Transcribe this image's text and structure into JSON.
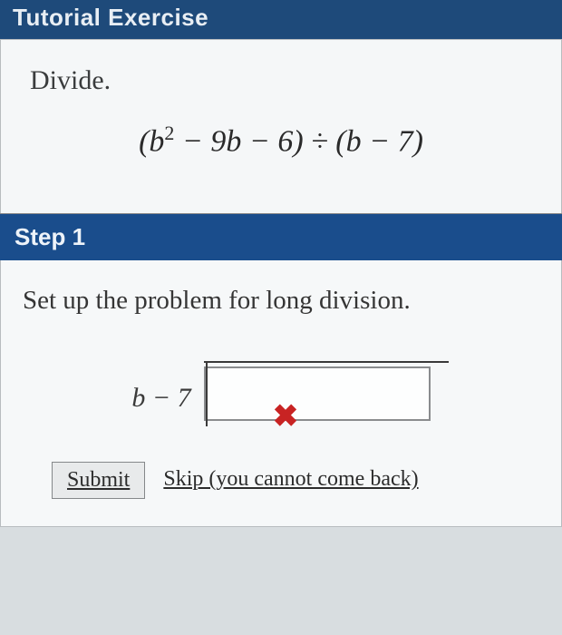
{
  "header": {
    "title": "Tutorial Exercise"
  },
  "problem": {
    "instruction": "Divide.",
    "expression_html": "(b² − 9b − 6) ÷ (b − 7)"
  },
  "step": {
    "label": "Step 1",
    "text": "Set up the problem for long division.",
    "divisor": "b − 7",
    "dividend_value": "",
    "error_icon": "✖"
  },
  "actions": {
    "submit_label": "Submit",
    "skip_label": "Skip (you cannot come back)"
  }
}
